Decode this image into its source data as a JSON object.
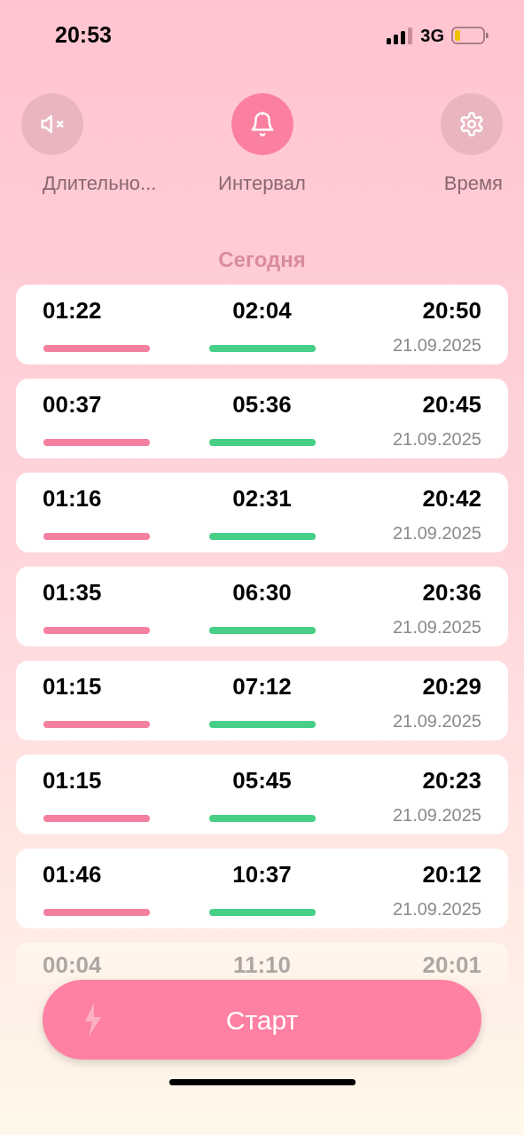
{
  "status_bar": {
    "time": "20:53",
    "network": "3G"
  },
  "tabs": [
    {
      "kind": "mute",
      "label": "Длительно...",
      "selected": false
    },
    {
      "kind": "bell",
      "label": "Интервал",
      "selected": true
    },
    {
      "kind": "gear",
      "label": "Время",
      "selected": false
    }
  ],
  "section_title": "Сегодня",
  "entries": [
    {
      "duration": "01:22",
      "interval": "02:04",
      "time": "20:50",
      "date": "21.09.2025",
      "faded": false
    },
    {
      "duration": "00:37",
      "interval": "05:36",
      "time": "20:45",
      "date": "21.09.2025",
      "faded": false
    },
    {
      "duration": "01:16",
      "interval": "02:31",
      "time": "20:42",
      "date": "21.09.2025",
      "faded": false
    },
    {
      "duration": "01:35",
      "interval": "06:30",
      "time": "20:36",
      "date": "21.09.2025",
      "faded": false
    },
    {
      "duration": "01:15",
      "interval": "07:12",
      "time": "20:29",
      "date": "21.09.2025",
      "faded": false
    },
    {
      "duration": "01:15",
      "interval": "05:45",
      "time": "20:23",
      "date": "21.09.2025",
      "faded": false
    },
    {
      "duration": "01:46",
      "interval": "10:37",
      "time": "20:12",
      "date": "21.09.2025",
      "faded": false
    },
    {
      "duration": "00:04",
      "interval": "11:10",
      "time": "20:01",
      "faded": true
    }
  ],
  "start_button": {
    "label": "Старт"
  }
}
